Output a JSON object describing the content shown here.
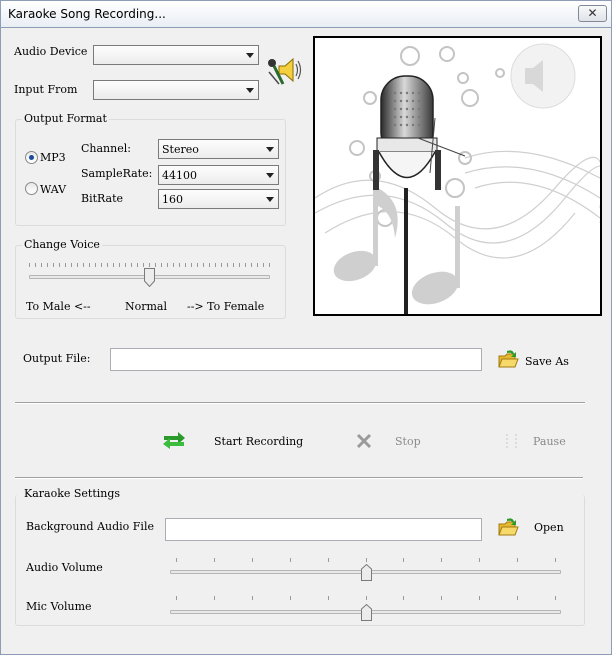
{
  "window": {
    "title": "Karaoke Song Recording...",
    "close_glyph": "✕"
  },
  "audio_device": {
    "label": "Audio Device",
    "value": ""
  },
  "input_from": {
    "label": "Input From",
    "value": ""
  },
  "output_format": {
    "legend": "Output Format",
    "mp3_label": "MP3",
    "wav_label": "WAV",
    "selected": "MP3",
    "channel_label": "Channel:",
    "channel_value": "Stereo",
    "samplerate_label": "SampleRate:",
    "samplerate_value": "44100",
    "bitrate_label": "BitRate",
    "bitrate_value": "160"
  },
  "change_voice": {
    "legend": "Change Voice",
    "left_label": "To Male <--",
    "center_label": "Normal",
    "right_label": "--> To Female",
    "level": 0.5
  },
  "output_file": {
    "label": "Output File:",
    "value": "",
    "save_as_label": "Save As"
  },
  "controls": {
    "start_label": "Start Recording",
    "stop_label": "Stop",
    "pause_label": "Pause"
  },
  "karaoke_settings": {
    "legend": "Karaoke Settings",
    "bg_audio_label": "Background Audio File",
    "bg_audio_value": "",
    "open_label": "Open",
    "audio_volume_label": "Audio Volume",
    "audio_volume_level": 0.5,
    "mic_volume_label": "Mic Volume",
    "mic_volume_level": 0.5
  },
  "colors": {
    "accent": "#1a4a9b",
    "start_icon_green": "#2a9a2a",
    "folder_yellow": "#f2c94c"
  },
  "icons": {
    "speaker_mic": "speaker-mic-icon",
    "folder_open": "folder-open-icon",
    "start": "swap-arrows-icon",
    "stop": "x-icon",
    "pause": "pause-icon"
  }
}
